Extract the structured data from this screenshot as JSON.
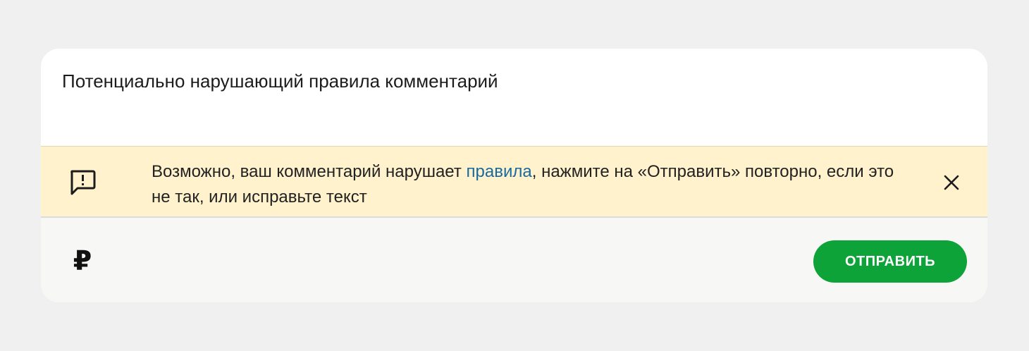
{
  "comment": {
    "text": "Потенциально нарушающий правила комментарий"
  },
  "warning": {
    "icon": "comment-alert-icon",
    "text_before": "Возможно, ваш комментарий нарушает ",
    "link_label": "правила",
    "text_after": ", нажмите на «Отправить» повторно, если это не так, или исправьте текст",
    "close_icon": "close-icon"
  },
  "footer": {
    "currency_symbol": "₽",
    "send_label": "ОТПРАВИТЬ"
  },
  "colors": {
    "page_background": "#f0f0f0",
    "warning_background": "#fff2cc",
    "link": "#1a6aa0",
    "send_button": "#0ea338",
    "footer_background": "#f7f7f5"
  }
}
